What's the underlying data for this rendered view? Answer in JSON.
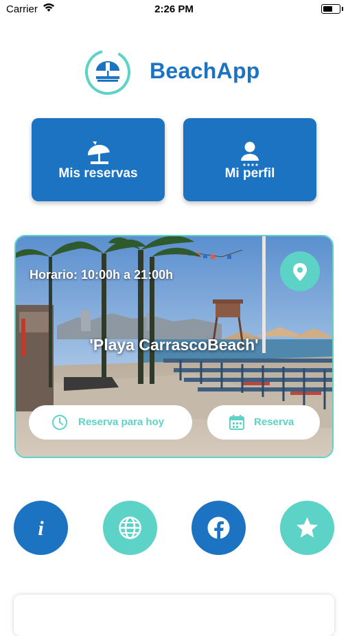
{
  "status_bar": {
    "carrier": "Carrier",
    "time": "2:26 PM"
  },
  "header": {
    "app_name": "BeachApp"
  },
  "quick_actions": [
    {
      "label": "Mis reservas",
      "icon": "beach-umbrella-icon"
    },
    {
      "label": "Mi perfil",
      "icon": "user-icon"
    }
  ],
  "beach_card": {
    "hours": "Horario: 10:00h a 21:00h",
    "name": "'Playa CarrascoBeach'",
    "location_icon": "location-pin-icon",
    "reserve_today_label": "Reserva para hoy",
    "reserve_label": "Reserva"
  },
  "shortcuts": [
    {
      "icon": "info-icon",
      "color": "#1b73c1"
    },
    {
      "icon": "globe-icon",
      "color": "#5cd3c6"
    },
    {
      "icon": "facebook-icon",
      "color": "#1b73c1"
    },
    {
      "icon": "star-icon",
      "color": "#5cd3c6"
    }
  ],
  "colors": {
    "primary": "#1b73c1",
    "accent": "#5cd3c6"
  }
}
